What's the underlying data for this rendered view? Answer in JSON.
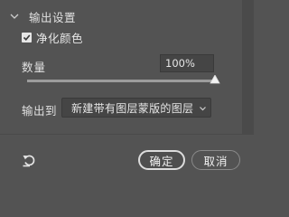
{
  "section": {
    "title": "输出设置",
    "icon": "chevron-down-icon"
  },
  "decontaminate": {
    "label": "净化颜色",
    "checked": true
  },
  "amount": {
    "label": "数量",
    "value": "100%",
    "slider_fraction": 1.0
  },
  "output": {
    "label": "输出到",
    "selected": "新建带有图层蒙版的图层"
  },
  "footer": {
    "reset_icon": "reset-icon",
    "ok_label": "确定",
    "cancel_label": "取消"
  },
  "colors": {
    "panel_bg": "#535353",
    "text": "#e0e0e0",
    "input_bg": "#454545"
  }
}
